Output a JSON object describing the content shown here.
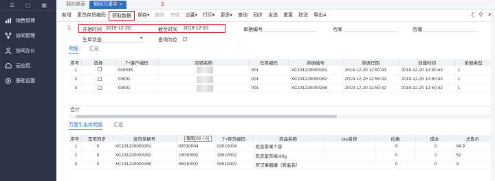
{
  "sidebar": {
    "top_icons": [
      "menu-icon",
      "doc-icon",
      "grid-icon"
    ],
    "items": [
      {
        "label": "销售管理",
        "icon": "chart-icon"
      },
      {
        "label": "协同管理",
        "icon": "node-icon"
      },
      {
        "label": "协同办公",
        "icon": "person-icon"
      },
      {
        "label": "云应用",
        "icon": "cloud-icon"
      },
      {
        "label": "基础设置",
        "icon": "settings-icon"
      }
    ]
  },
  "tabs": [
    {
      "label": "我的桌面"
    },
    {
      "label": "协同万里牛",
      "close": "×"
    }
  ],
  "annotations": {
    "one": "1.",
    "two": "2."
  },
  "toolbar": {
    "buttons": [
      "新增",
      "更改存货编码",
      "获取数据",
      "保存▾",
      "删除",
      "审核",
      "设置▾",
      "打印▾",
      "更多▾",
      "查询",
      "同步",
      "全选",
      "重置",
      "取消",
      "导出A"
    ],
    "right_icons": [
      "ζ",
      "⚲",
      "✕"
    ]
  },
  "filter": {
    "start_label": "开始时间",
    "start_value": "2019-12-20",
    "end_label": "截至时间",
    "end_value": "2019-12-20",
    "doc_no_label": "单据编号",
    "warehouse_label": "仓库",
    "store_label": "店铺",
    "gen_status_label": "生单状态",
    "query_empty_label": "查询为空"
  },
  "subtabs1": [
    "明细",
    "汇总"
  ],
  "grid1": {
    "headers": [
      "序号",
      "选择",
      "T+客户编码",
      "店铺名称",
      "仓库编码",
      "单据编号",
      "单据日期",
      "创建时间",
      "单据类型"
    ],
    "rows": [
      {
        "idx": "1",
        "cust": "020035",
        "wh": "001",
        "doc": "XC191220000161",
        "date": "2019-12-20 12:50:43",
        "created": "2019-12-20 12:50:43",
        "type": "1"
      },
      {
        "idx": "2",
        "cust": "03001",
        "wh": "001",
        "doc": "XC191220000162",
        "date": "2019-12-20 12:50:43",
        "created": "2019-12-20 12:50:43",
        "type": "1"
      },
      {
        "idx": "3",
        "cust": "03001",
        "wh": "001",
        "doc": "XC191220000156",
        "date": "2019-12-20 12:50:42",
        "created": "2019-12-20 12:50:42",
        "type": "1"
      }
    ],
    "total_label": "合计"
  },
  "subtabs2": [
    "万里牛出库明细",
    "汇总"
  ],
  "tooltip": "截图(Alt + A)",
  "grid2": {
    "headers": [
      "序号",
      "是否同步",
      "发货单据号",
      "sku编码",
      "T+存货编码",
      "商品名称",
      "sku名称",
      "优惠",
      "成本",
      "总售价"
    ],
    "rows": [
      {
        "idx": "1",
        "sync": "0",
        "doc": "XC191220000161",
        "sku": "02010004",
        "tcode": "02010004",
        "name": "炬普茶果个装",
        "skuname": "",
        "disc": "0",
        "cost": "0",
        "total": "94.9"
      },
      {
        "idx": "2",
        "sync": "0",
        "doc": "XC191220000162",
        "sku": "19010002",
        "tcode": "19010002",
        "name": "陈皮紫苏梅-60g",
        "skuname": "",
        "disc": "0",
        "cost": "0",
        "total": "52"
      },
      {
        "idx": "3",
        "sync": "0",
        "doc": "XC191220000156",
        "sku": "05010002",
        "tcode": "05010002",
        "name": "罗汉果糖罐（铁盒装）",
        "skuname": "",
        "disc": "0",
        "cost": "0",
        "total": "9"
      }
    ]
  }
}
